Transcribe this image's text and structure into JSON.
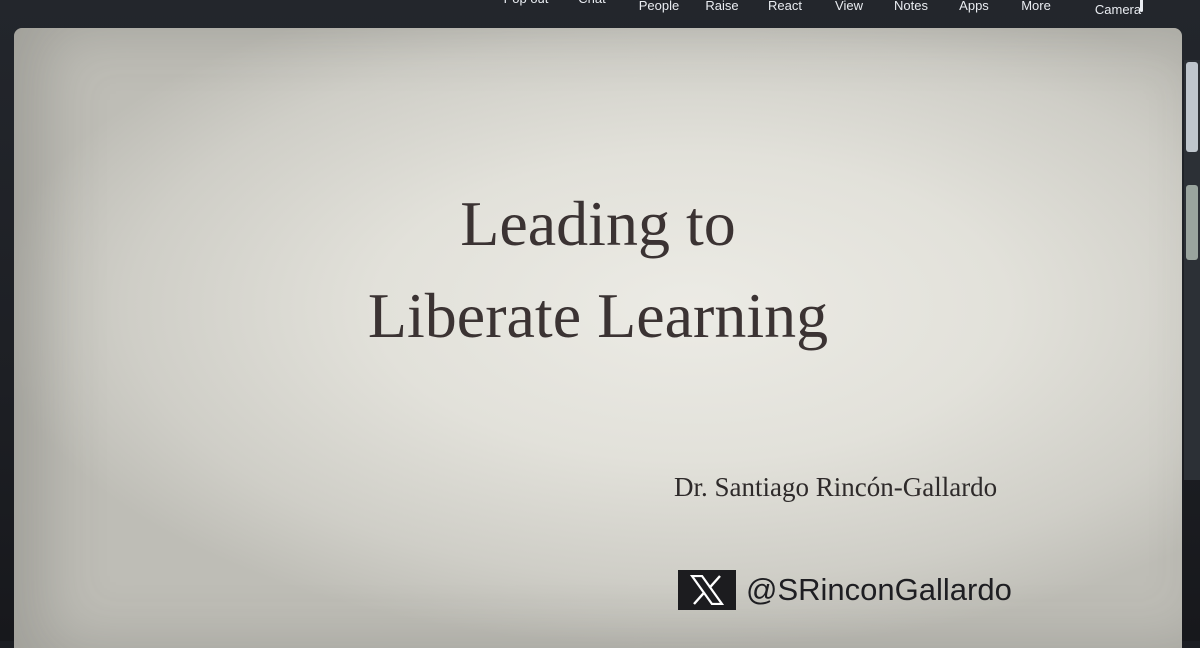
{
  "toolbar": {
    "items": [
      {
        "label": "Pop out",
        "icon": "pop-out-icon"
      },
      {
        "label": "Chat",
        "icon": "chat-icon"
      },
      {
        "label": "People",
        "icon": "people-icon"
      },
      {
        "label": "Raise",
        "icon": "raise-hand-icon"
      },
      {
        "label": "React",
        "icon": "react-icon"
      },
      {
        "label": "View",
        "icon": "view-icon"
      },
      {
        "label": "Notes",
        "icon": "notes-icon"
      },
      {
        "label": "Apps",
        "icon": "apps-icon"
      },
      {
        "label": "More",
        "icon": "more-icon"
      },
      {
        "label": "Camera",
        "icon": "camera-icon"
      }
    ]
  },
  "slide": {
    "title_line1": "Leading to",
    "title_line2": "Liberate Learning",
    "author": "Dr. Santiago Rincón-Gallardo",
    "handle": "@SRinconGallardo",
    "handle_icon": "x-logo-icon",
    "colors": {
      "text": "#3b3333",
      "background": "#e6e5df",
      "logo": "#1c1c1f"
    }
  }
}
